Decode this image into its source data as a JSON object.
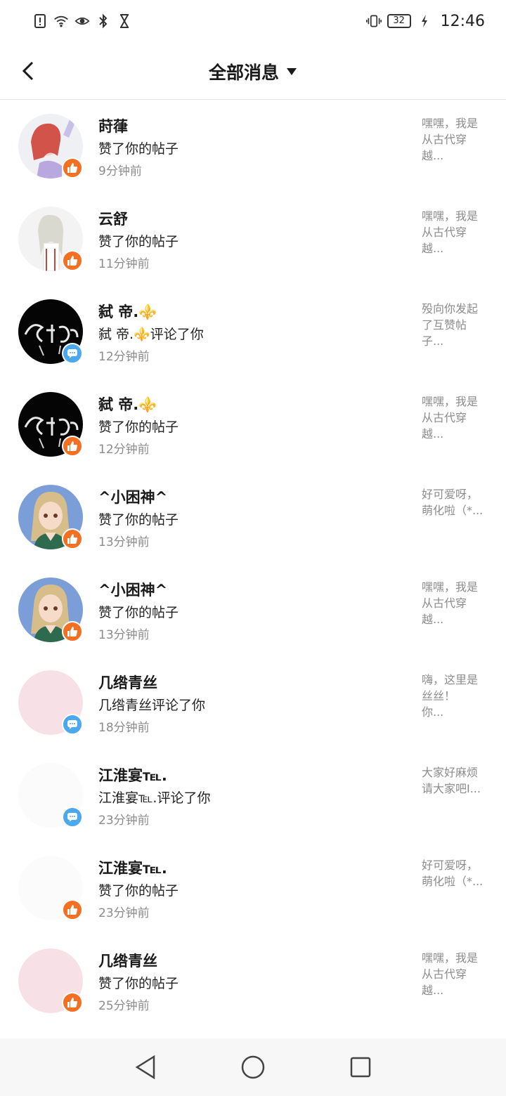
{
  "status_bar": {
    "time": "12:46",
    "battery": "32",
    "icons": [
      "alert-icon",
      "wifi-icon",
      "eye-icon",
      "bluetooth-icon",
      "hourglass-icon",
      "vibrate-icon",
      "charging-icon"
    ]
  },
  "header": {
    "title": "全部消息",
    "back_icon": "chevron-left-icon",
    "dropdown_icon": "caret-down-icon"
  },
  "colors": {
    "like_badge": "#f36f21",
    "comment_badge": "#4aa8ef",
    "secondary_text": "#8c8c8c"
  },
  "messages": [
    {
      "name": "莳葎",
      "action": "赞了你的帖子",
      "time": "9分钟前",
      "type": "like",
      "preview": [
        "嘿嘿，我是",
        "从古代穿",
        "越..."
      ],
      "avatar": "red-hair-anime-avatar"
    },
    {
      "name": "云舒",
      "action": "赞了你的帖子",
      "time": "11分钟前",
      "type": "like",
      "preview": [
        "嘿嘿，我是",
        "从古代穿",
        "越..."
      ],
      "avatar": "white-hair-anime-avatar"
    },
    {
      "name": "弑 帝.⚜️",
      "action": "弑 帝.⚜️评论了你",
      "time": "12分钟前",
      "type": "comment",
      "preview": [
        "殁向你发起",
        "了互赞帖",
        "子..."
      ],
      "avatar": "dark-logo-avatar"
    },
    {
      "name": "弑 帝.⚜️",
      "action": "赞了你的帖子",
      "time": "12分钟前",
      "type": "like",
      "preview": [
        "嘿嘿，我是",
        "从古代穿",
        "越..."
      ],
      "avatar": "dark-logo-avatar"
    },
    {
      "name": "^小困神^",
      "action": "赞了你的帖子",
      "time": "13分钟前",
      "type": "like",
      "preview": [
        "好可爱呀，",
        "萌化啦（*..."
      ],
      "avatar": "blonde-anime-avatar"
    },
    {
      "name": "^小困神^",
      "action": "赞了你的帖子",
      "time": "13分钟前",
      "type": "like",
      "preview": [
        "嘿嘿，我是",
        "从古代穿",
        "越..."
      ],
      "avatar": "blonde-anime-avatar"
    },
    {
      "name": "几绺青丝",
      "action": "几绺青丝评论了你",
      "time": "18分钟前",
      "type": "comment",
      "preview": [
        "嗨，这里是",
        "丝丝！",
        "你..."
      ],
      "avatar": "pink-blank-avatar"
    },
    {
      "name": "江淮宴℡.",
      "action": "江淮宴℡.评论了你",
      "time": "23分钟前",
      "type": "comment",
      "preview": [
        "大家好麻烦",
        "请大家吧I..."
      ],
      "avatar": "white-blank-avatar"
    },
    {
      "name": "江淮宴℡.",
      "action": "赞了你的帖子",
      "time": "23分钟前",
      "type": "like",
      "preview": [
        "好可爱呀，",
        "萌化啦（*..."
      ],
      "avatar": "white-blank-avatar"
    },
    {
      "name": "几绺青丝",
      "action": "赞了你的帖子",
      "time": "25分钟前",
      "type": "like",
      "preview": [
        "嘿嘿，我是",
        "从古代穿",
        "越..."
      ],
      "avatar": "pink-blank-avatar"
    }
  ],
  "nav_bar": {
    "buttons": [
      "back-triangle-icon",
      "home-circle-icon",
      "recents-square-icon"
    ]
  }
}
